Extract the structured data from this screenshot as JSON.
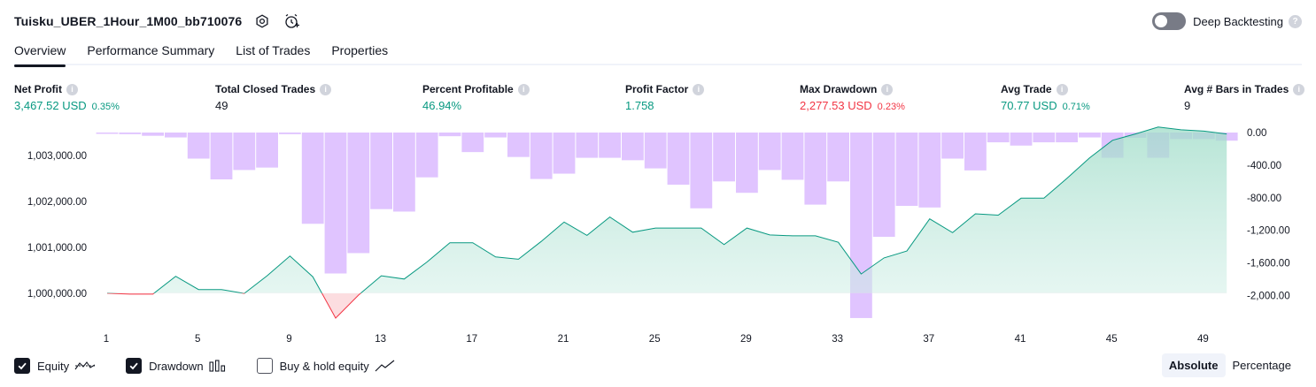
{
  "header": {
    "strategy_name": "Tuisku_UBER_1Hour_1M00_bb710076",
    "deep_backtesting_label": "Deep Backtesting",
    "deep_backtesting_enabled": false,
    "help_glyph": "?"
  },
  "tabs": [
    {
      "label": "Overview",
      "active": true
    },
    {
      "label": "Performance Summary",
      "active": false
    },
    {
      "label": "List of Trades",
      "active": false
    },
    {
      "label": "Properties",
      "active": false
    }
  ],
  "metrics": [
    {
      "label": "Net Profit",
      "value": "3,467.52 USD",
      "pct": "0.35%",
      "color": "#089981"
    },
    {
      "label": "Total Closed Trades",
      "value": "49",
      "pct": "",
      "color": "#131722"
    },
    {
      "label": "Percent Profitable",
      "value": "46.94%",
      "pct": "",
      "color": "#089981"
    },
    {
      "label": "Profit Factor",
      "value": "1.758",
      "pct": "",
      "color": "#089981"
    },
    {
      "label": "Max Drawdown",
      "value": "2,277.53 USD",
      "pct": "0.23%",
      "color": "#f23645"
    },
    {
      "label": "Avg Trade",
      "value": "70.77 USD",
      "pct": "0.71%",
      "color": "#089981"
    },
    {
      "label": "Avg # Bars in Trades",
      "value": "9",
      "pct": "",
      "color": "#131722"
    }
  ],
  "info_glyph": "i",
  "chart_data": {
    "type": "area",
    "x_ticks": [
      "1",
      "5",
      "9",
      "13",
      "17",
      "21",
      "25",
      "29",
      "33",
      "37",
      "41",
      "45",
      "49"
    ],
    "left_axis": {
      "ticks": [
        "1,003,000.00",
        "1,002,000.00",
        "1,001,000.00",
        "1,000,000.00"
      ],
      "tick_values": [
        1003000,
        1002000,
        1001000,
        1000000
      ],
      "range": [
        999459,
        1003500
      ]
    },
    "right_axis": {
      "ticks": [
        "0.00",
        "-400.00",
        "-800.00",
        "-1,200.00",
        "-1,600.00",
        "-2,000.00"
      ],
      "tick_values": [
        0,
        -400,
        -800,
        -1200,
        -1600,
        -2000
      ],
      "range": [
        -2277.53,
        0
      ]
    },
    "series": [
      {
        "name": "Equity",
        "color": "#089981",
        "fill": "#d6f1ea",
        "negative_color": "#f23645",
        "baseline": 1000000,
        "x": [
          1,
          2,
          3,
          4,
          5,
          6,
          7,
          8,
          9,
          10,
          11,
          12,
          13,
          14,
          15,
          16,
          17,
          18,
          19,
          20,
          21,
          22,
          23,
          24,
          25,
          26,
          27,
          28,
          29,
          30,
          31,
          32,
          33,
          34,
          35,
          36,
          37,
          38,
          39,
          40,
          41,
          42,
          43,
          44,
          45,
          46,
          47,
          48,
          49,
          50
        ],
        "values": [
          1000000,
          999980,
          999980,
          1000370,
          1000080,
          1000080,
          999995,
          1000380,
          1000810,
          1000360,
          999459,
          999960,
          1000380,
          1000310,
          1000680,
          1001100,
          1001100,
          1000790,
          1000740,
          1001130,
          1001550,
          1001260,
          1001660,
          1001330,
          1001420,
          1001420,
          1001420,
          1001060,
          1001420,
          1001270,
          1001250,
          1001250,
          1001110,
          1000420,
          1000770,
          1000920,
          1001620,
          1001320,
          1001730,
          1001700,
          1002070,
          1002070,
          1002500,
          1002950,
          1003330,
          1003470,
          1003620,
          1003560,
          1003530,
          1003470
        ]
      },
      {
        "name": "Drawdown",
        "color": "#cc9cff",
        "opacity": 0.6,
        "x": [
          1,
          2,
          3,
          4,
          5,
          6,
          7,
          8,
          9,
          10,
          11,
          12,
          13,
          14,
          15,
          16,
          17,
          18,
          19,
          20,
          21,
          22,
          23,
          24,
          25,
          26,
          27,
          28,
          29,
          30,
          31,
          32,
          33,
          34,
          35,
          36,
          37,
          38,
          39,
          40,
          41,
          42,
          43,
          44,
          45,
          46,
          47,
          48,
          49,
          50
        ],
        "values": [
          0,
          -20,
          -40,
          -60,
          -320,
          -575,
          -460,
          -430,
          -20,
          -1120,
          -1730,
          -1480,
          -940,
          -970,
          -550,
          -45,
          -240,
          -60,
          -300,
          -570,
          -505,
          -310,
          -310,
          -340,
          -440,
          -640,
          -930,
          -600,
          -740,
          -460,
          -580,
          -885,
          -600,
          -2277,
          -1280,
          -900,
          -920,
          -320,
          -465,
          -120,
          -160,
          -120,
          -120,
          -60,
          -310,
          -65,
          -310,
          -80,
          -80,
          -100
        ]
      }
    ],
    "legend": [
      {
        "name": "Equity",
        "checked": true
      },
      {
        "name": "Drawdown",
        "checked": true
      },
      {
        "name": "Buy & hold equity",
        "checked": false
      }
    ],
    "grid": false,
    "modes": [
      {
        "label": "Absolute",
        "active": true
      },
      {
        "label": "Percentage",
        "active": false
      }
    ]
  }
}
